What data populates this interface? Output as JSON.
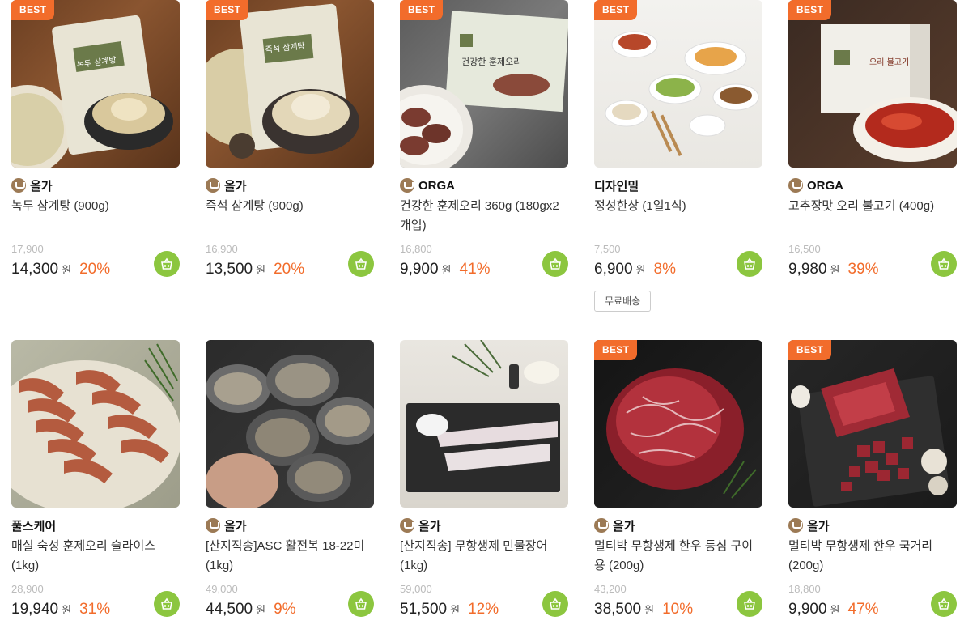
{
  "badge_label": "BEST",
  "currency": "원",
  "free_shipping_label": "무료배송",
  "colors": {
    "accent": "#f26c2b",
    "cart": "#8cc63f",
    "brand_mark": "#9c7a55"
  },
  "products": [
    {
      "best": true,
      "brand": "올가",
      "brand_logo": true,
      "name": "녹두 삼계탕 (900g)",
      "original_price": "17,900",
      "price": "14,300",
      "discount": "20%",
      "free_shipping": false,
      "package_text": "녹두 삼계탕"
    },
    {
      "best": true,
      "brand": "올가",
      "brand_logo": true,
      "name": "즉석 삼계탕 (900g)",
      "original_price": "16,900",
      "price": "13,500",
      "discount": "20%",
      "free_shipping": false,
      "package_text": "즉석 삼계탕"
    },
    {
      "best": true,
      "brand": "ORGA",
      "brand_logo": true,
      "name": "건강한 훈제오리 360g (180gx2개입)",
      "original_price": "16,800",
      "price": "9,900",
      "discount": "41%",
      "free_shipping": false,
      "package_text": "건강한 훈제오리"
    },
    {
      "best": true,
      "brand": "디자인밀",
      "brand_logo": false,
      "name": "정성한상 (1일1식)",
      "original_price": "7,500",
      "price": "6,900",
      "discount": "8%",
      "free_shipping": true,
      "package_text": ""
    },
    {
      "best": true,
      "brand": "ORGA",
      "brand_logo": true,
      "name": "고추장맛 오리 불고기 (400g)",
      "original_price": "16,500",
      "price": "9,980",
      "discount": "39%",
      "free_shipping": false,
      "package_text": "오리 불고기"
    },
    {
      "best": false,
      "brand": "풀스케어",
      "brand_logo": false,
      "name": "매실 숙성 훈제오리 슬라이스 (1kg)",
      "original_price": "28,900",
      "price": "19,940",
      "discount": "31%",
      "free_shipping": false,
      "package_text": ""
    },
    {
      "best": false,
      "brand": "올가",
      "brand_logo": true,
      "name": "[산지직송]ASC 활전복 18-22미(1kg)",
      "original_price": "49,000",
      "price": "44,500",
      "discount": "9%",
      "free_shipping": false,
      "package_text": ""
    },
    {
      "best": false,
      "brand": "올가",
      "brand_logo": true,
      "name": "[산지직송] 무항생제 민물장어 (1kg)",
      "original_price": "59,000",
      "price": "51,500",
      "discount": "12%",
      "free_shipping": false,
      "package_text": ""
    },
    {
      "best": true,
      "brand": "올가",
      "brand_logo": true,
      "name": "멀티박 무항생제 한우 등심 구이용 (200g)",
      "original_price": "43,200",
      "price": "38,500",
      "discount": "10%",
      "free_shipping": false,
      "package_text": ""
    },
    {
      "best": true,
      "brand": "올가",
      "brand_logo": true,
      "name": "멀티박 무항생제 한우 국거리 (200g)",
      "original_price": "18,800",
      "price": "9,900",
      "discount": "47%",
      "free_shipping": false,
      "package_text": ""
    }
  ]
}
